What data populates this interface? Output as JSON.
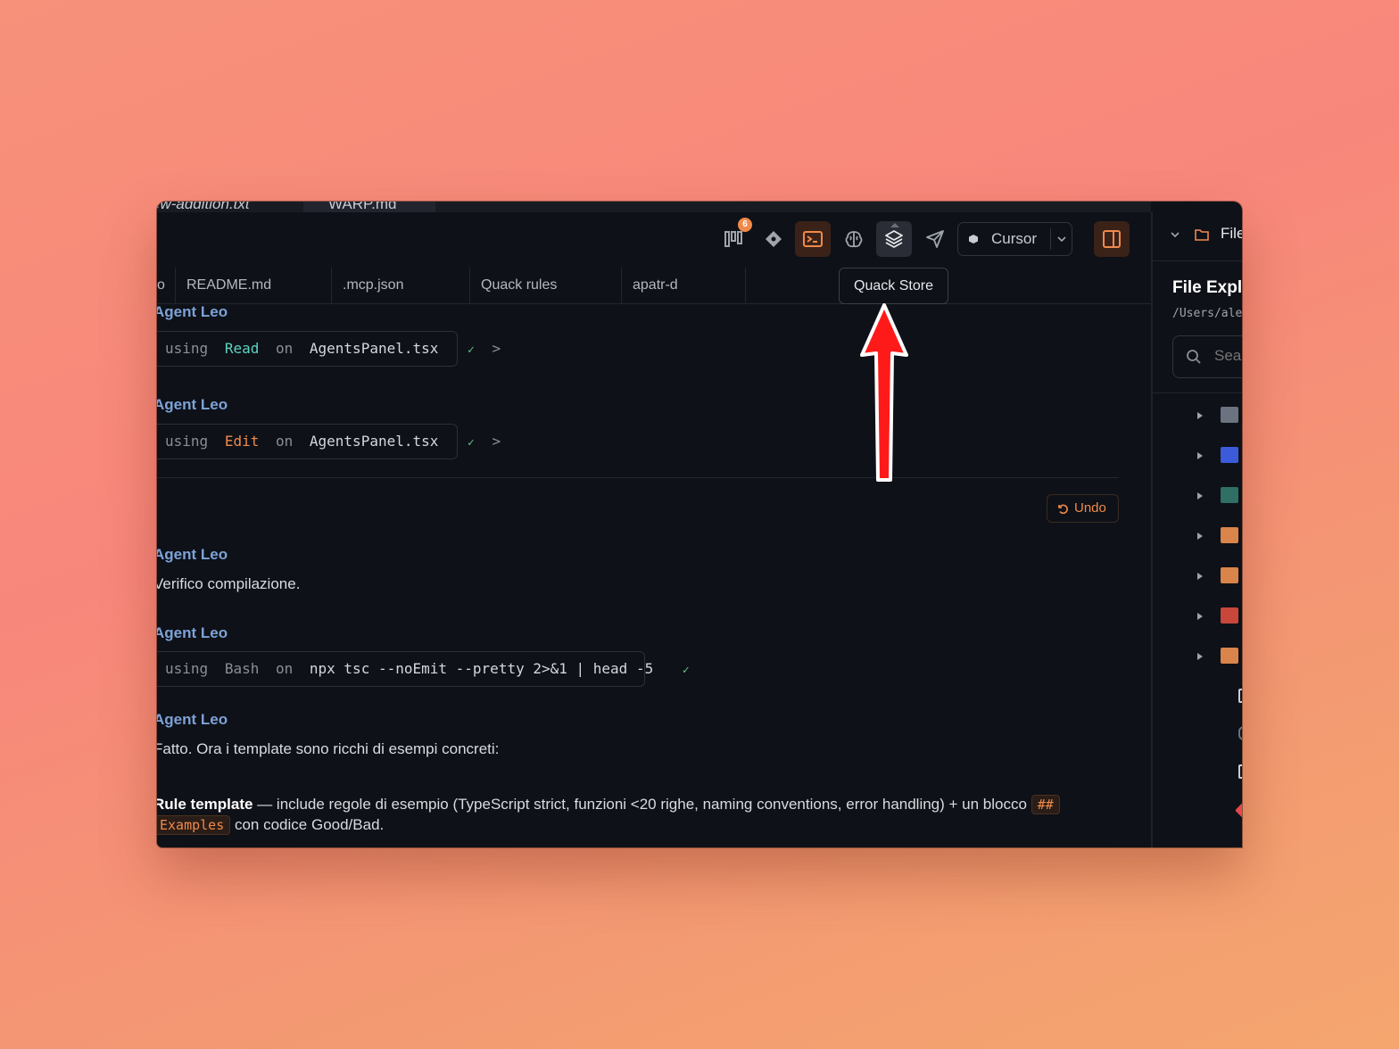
{
  "file_tabs": [
    {
      "label": "ew-addition.txt",
      "active": false
    },
    {
      "label": "WARP.md",
      "active": true
    }
  ],
  "toolbar": {
    "kanban_badge": "6",
    "cursor_label": "Cursor",
    "buttons": [
      "kanban-icon",
      "diamond-icon",
      "terminal-icon",
      "brain-icon",
      "layers-icon",
      "send-icon"
    ]
  },
  "doc_tabs": [
    "o",
    "README.md",
    ".mcp.json",
    "Quack rules",
    "apatr-d"
  ],
  "tooltip": "Quack Store",
  "chat": {
    "agent_name": "Agent Leo",
    "tool1": {
      "using": "using",
      "tool": "Read",
      "on": "on",
      "file": "AgentsPanel.tsx",
      "check": "✓",
      "chevron": ">"
    },
    "tool2": {
      "using": "using",
      "tool": "Edit",
      "on": "on",
      "file": "AgentsPanel.tsx",
      "check": "✓",
      "chevron": ">"
    },
    "undo_label": "Undo",
    "msg1": "Verifico compilazione.",
    "tool3": {
      "using": "using",
      "tool": "Bash",
      "on": "on",
      "command": "npx tsc --noEmit --pretty 2>&1 | head -5",
      "check": "✓"
    },
    "msg2": "Fatto. Ora i template sono ricchi di esempi concreti:",
    "rule_bold": "Rule template",
    "rule_text": " — include regole di esempio (TypeScript strict, funzioni <20 righe, naming conventions, error handling) + un blocco ",
    "rule_code1": "##",
    "rule_code2": "Examples",
    "rule_tail": " con codice Good/Bad."
  },
  "right_panel": {
    "header": "Files",
    "title": "File Explorer",
    "path": "/Users/alex",
    "search_placeholder": "Search"
  },
  "colors": {
    "accent": "#f08a4b",
    "agent_name": "#7da2d8",
    "read_tool": "#5fd3c3",
    "success": "#5fc490",
    "background": "#0e1117",
    "arrow": "#ff0000"
  }
}
